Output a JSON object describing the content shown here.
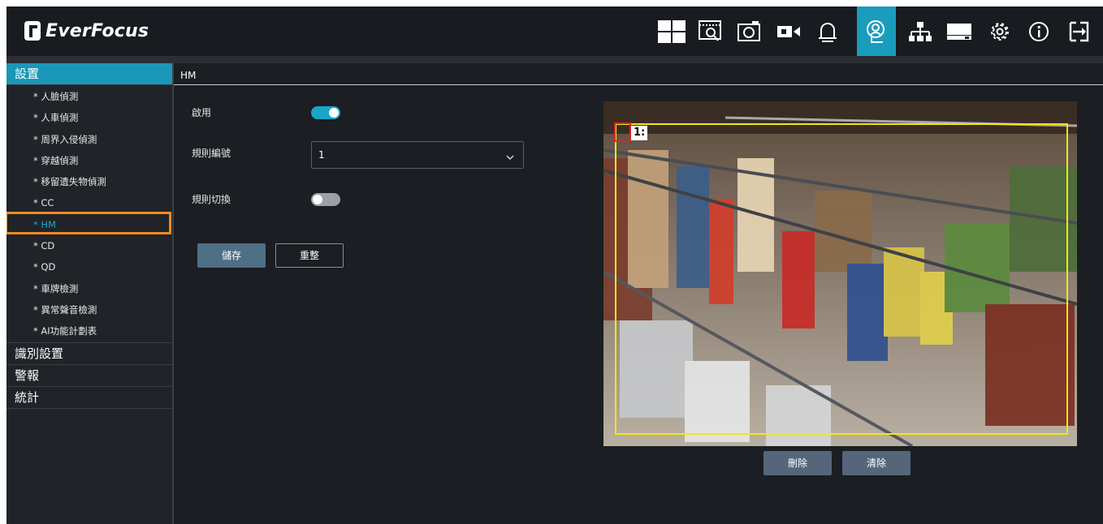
{
  "brand": {
    "name": "EverFocus"
  },
  "toolbar": {
    "icons": [
      "layout-grid-icon",
      "playback-icon",
      "snapshot-icon",
      "record-icon",
      "alarm-bell-icon",
      "ai-face-icon",
      "network-icon",
      "storage-icon",
      "gear-icon",
      "info-icon",
      "logout-icon"
    ],
    "active_icon": "ai-face-icon",
    "active_color": "#1a9cbd"
  },
  "sidebar": {
    "sections": [
      {
        "label": "設置",
        "active": true,
        "items": [
          "* 人臉偵測",
          "* 人車偵測",
          "* 周界入侵偵測",
          "* 穿越偵測",
          "* 移留遺失物偵測",
          "* CC",
          "* HM",
          "* CD",
          "* QD",
          "* 車牌檢測",
          "* 異常聲音檢測",
          "* AI功能計劃表"
        ],
        "selected_item": "* HM"
      },
      {
        "label": "識別設置"
      },
      {
        "label": "警報"
      },
      {
        "label": "統計"
      }
    ],
    "highlight_color": "#f08a24"
  },
  "main": {
    "title": "HM",
    "form": {
      "enable_label": "啟用",
      "enable_on": true,
      "rule_number_label": "規則編號",
      "rule_number_value": "1",
      "rule_switch_label": "規則切換",
      "rule_switch_on": false
    },
    "buttons": {
      "save": "儲存",
      "reset": "重整"
    },
    "video": {
      "roi_label": "1:",
      "roi_color": "#f2e51a",
      "handle_color": "#e0241f"
    },
    "video_buttons": {
      "delete": "刪除",
      "clear": "清除"
    }
  }
}
